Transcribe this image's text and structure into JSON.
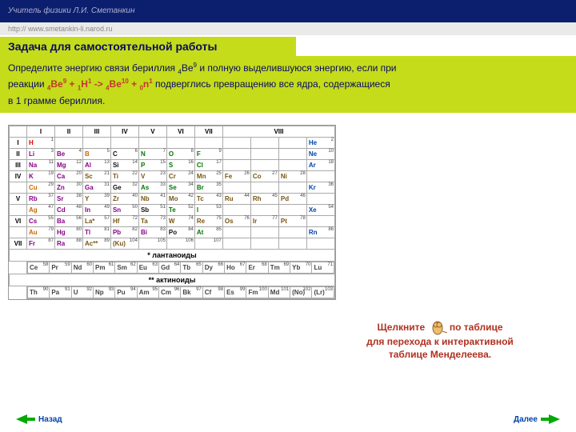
{
  "header": {
    "teacher": "Учитель физики Л.И. Сметанкин",
    "url": "http:// www.smetankin-li.narod.ru"
  },
  "task": {
    "title": "Задача для самостоятельной работы",
    "line1a": "Определите энергию связи бериллия ",
    "be9_sub": "4",
    "be9_el": "Be",
    "be9_sup": "9",
    "line1b": " и полную выделившуюся энергию, если при",
    "line2a": "реакции   ",
    "r_be9_sub": "4",
    "r_be9_el": "Be",
    "r_be9_sup": "9",
    "plus1": " + ",
    "r_h_sub": "1",
    "r_h_el": "H",
    "r_h_sup": "1",
    "arrow": " -> ",
    "r_be10_sub": "4",
    "r_be10_el": "Be",
    "r_be10_sup": "10",
    "plus2": " + ",
    "r_n_sub": "0",
    "r_n_el": "n",
    "r_n_sup": "1",
    "line2b": " подверглись превращению все ядра, содержащиеся",
    "line3": "в 1 грамме бериллия."
  },
  "ptable": {
    "groups": [
      "I",
      "II",
      "III",
      "IV",
      "V",
      "VI",
      "VII",
      "VIII"
    ],
    "periods": [
      "I",
      "II",
      "III",
      "IV",
      "",
      "V",
      "",
      "VI",
      "",
      "VII"
    ],
    "rows": [
      [
        [
          "H",
          "1",
          "c-red"
        ],
        [
          ""
        ],
        [
          ""
        ],
        [
          ""
        ],
        [
          ""
        ],
        [
          ""
        ],
        [
          ""
        ],
        [
          ""
        ],
        [
          ""
        ],
        [
          ""
        ],
        [
          "He",
          "2",
          "c-blue"
        ]
      ],
      [
        [
          "Li",
          "3",
          "c-purple"
        ],
        [
          "Be",
          "4",
          "c-purple"
        ],
        [
          "B",
          "5",
          "c-orange"
        ],
        [
          "C",
          "6",
          "c-black"
        ],
        [
          "N",
          "7",
          "c-green"
        ],
        [
          "O",
          "8",
          "c-green"
        ],
        [
          "F",
          "9",
          "c-green"
        ],
        [
          ""
        ],
        [
          ""
        ],
        [
          ""
        ],
        [
          "Ne",
          "10",
          "c-blue"
        ]
      ],
      [
        [
          "Na",
          "11",
          "c-purple"
        ],
        [
          "Mg",
          "12",
          "c-purple"
        ],
        [
          "Al",
          "13",
          "c-purple"
        ],
        [
          "Si",
          "14",
          "c-black"
        ],
        [
          "P",
          "15",
          "c-green"
        ],
        [
          "S",
          "16",
          "c-green"
        ],
        [
          "Cl",
          "17",
          "c-green"
        ],
        [
          ""
        ],
        [
          ""
        ],
        [
          ""
        ],
        [
          "Ar",
          "18",
          "c-blue"
        ]
      ],
      [
        [
          "K",
          "19",
          "c-purple"
        ],
        [
          "Ca",
          "20",
          "c-purple"
        ],
        [
          "Sc",
          "21",
          "c-brown"
        ],
        [
          "Ti",
          "22",
          "c-brown"
        ],
        [
          "V",
          "23",
          "c-brown"
        ],
        [
          "Cr",
          "24",
          "c-brown"
        ],
        [
          "Mn",
          "25",
          "c-brown"
        ],
        [
          "Fe",
          "26",
          "c-brown"
        ],
        [
          "Co",
          "27",
          "c-brown"
        ],
        [
          "Ni",
          "28",
          "c-brown"
        ],
        [
          ""
        ]
      ],
      [
        [
          "Cu",
          "29",
          "c-orange"
        ],
        [
          "Zn",
          "30",
          "c-purple"
        ],
        [
          "Ga",
          "31",
          "c-purple"
        ],
        [
          "Ge",
          "32",
          "c-black"
        ],
        [
          "As",
          "33",
          "c-green"
        ],
        [
          "Se",
          "34",
          "c-green"
        ],
        [
          "Br",
          "35",
          "c-green"
        ],
        [
          ""
        ],
        [
          ""
        ],
        [
          ""
        ],
        [
          "Kr",
          "36",
          "c-blue"
        ]
      ],
      [
        [
          "Rb",
          "37",
          "c-purple"
        ],
        [
          "Sr",
          "38",
          "c-purple"
        ],
        [
          "Y",
          "39",
          "c-brown"
        ],
        [
          "Zr",
          "40",
          "c-brown"
        ],
        [
          "Nb",
          "41",
          "c-brown"
        ],
        [
          "Mo",
          "42",
          "c-brown"
        ],
        [
          "Tc",
          "43",
          "c-brown"
        ],
        [
          "Ru",
          "44",
          "c-brown"
        ],
        [
          "Rh",
          "45",
          "c-brown"
        ],
        [
          "Pd",
          "46",
          "c-brown"
        ],
        [
          ""
        ]
      ],
      [
        [
          "Ag",
          "47",
          "c-orange"
        ],
        [
          "Cd",
          "48",
          "c-purple"
        ],
        [
          "In",
          "49",
          "c-purple"
        ],
        [
          "Sn",
          "50",
          "c-purple"
        ],
        [
          "Sb",
          "51",
          "c-black"
        ],
        [
          "Te",
          "52",
          "c-green"
        ],
        [
          "I",
          "53",
          "c-green"
        ],
        [
          ""
        ],
        [
          ""
        ],
        [
          ""
        ],
        [
          "Xe",
          "54",
          "c-blue"
        ]
      ],
      [
        [
          "Cs",
          "55",
          "c-purple"
        ],
        [
          "Ba",
          "56",
          "c-purple"
        ],
        [
          "La*",
          "57",
          "c-brown"
        ],
        [
          "Hf",
          "72",
          "c-brown"
        ],
        [
          "Ta",
          "73",
          "c-brown"
        ],
        [
          "W",
          "74",
          "c-brown"
        ],
        [
          "Re",
          "75",
          "c-brown"
        ],
        [
          "Os",
          "76",
          "c-brown"
        ],
        [
          "Ir",
          "77",
          "c-brown"
        ],
        [
          "Pt",
          "78",
          "c-brown"
        ],
        [
          ""
        ]
      ],
      [
        [
          "Au",
          "79",
          "c-orange"
        ],
        [
          "Hg",
          "80",
          "c-purple"
        ],
        [
          "Tl",
          "81",
          "c-purple"
        ],
        [
          "Pb",
          "82",
          "c-purple"
        ],
        [
          "Bi",
          "83",
          "c-purple"
        ],
        [
          "Po",
          "84",
          "c-black"
        ],
        [
          "At",
          "85",
          "c-green"
        ],
        [
          ""
        ],
        [
          ""
        ],
        [
          ""
        ],
        [
          "Rn",
          "86",
          "c-blue"
        ]
      ],
      [
        [
          "Fr",
          "87",
          "c-purple"
        ],
        [
          "Ra",
          "88",
          "c-purple"
        ],
        [
          "Ac**",
          "89",
          "c-brown"
        ],
        [
          "(Ku)",
          "104",
          "c-brown"
        ],
        [
          " ",
          "105",
          "c-brown"
        ],
        [
          " ",
          "106",
          "c-brown"
        ],
        [
          " ",
          "107",
          "c-brown"
        ],
        [
          ""
        ],
        [
          ""
        ],
        [
          ""
        ],
        [
          ""
        ]
      ]
    ],
    "lanth_label": "* лантаноиды",
    "lanthanoids": [
      [
        "Ce",
        "58"
      ],
      [
        "Pr",
        "59"
      ],
      [
        "Nd",
        "60"
      ],
      [
        "Pm",
        "61"
      ],
      [
        "Sm",
        "62"
      ],
      [
        "Eu",
        "63"
      ],
      [
        "Gd",
        "64"
      ],
      [
        "Tb",
        "65"
      ],
      [
        "Dy",
        "66"
      ],
      [
        "Ho",
        "67"
      ],
      [
        "Er",
        "68"
      ],
      [
        "Tm",
        "69"
      ],
      [
        "Yb",
        "70"
      ],
      [
        "Lu",
        "71"
      ]
    ],
    "act_label": "** актиноиды",
    "actinoids": [
      [
        "Th",
        "90"
      ],
      [
        "Pa",
        "91"
      ],
      [
        "U",
        "92"
      ],
      [
        "Np",
        "93"
      ],
      [
        "Pu",
        "94"
      ],
      [
        "Am",
        "95"
      ],
      [
        "Cm",
        "96"
      ],
      [
        "Bk",
        "97"
      ],
      [
        "Cf",
        "98"
      ],
      [
        "Es",
        "99"
      ],
      [
        "Fm",
        "100"
      ],
      [
        "Md",
        "101"
      ],
      [
        "(No)",
        "102"
      ],
      [
        "(Lr)",
        "103"
      ]
    ]
  },
  "hint": {
    "pre": "Щелкните ",
    "post": " по таблице",
    "l2": "для перехода к интерактивной",
    "l3": "таблице Менделеева."
  },
  "nav": {
    "back": "Назад",
    "next": "Далее"
  }
}
